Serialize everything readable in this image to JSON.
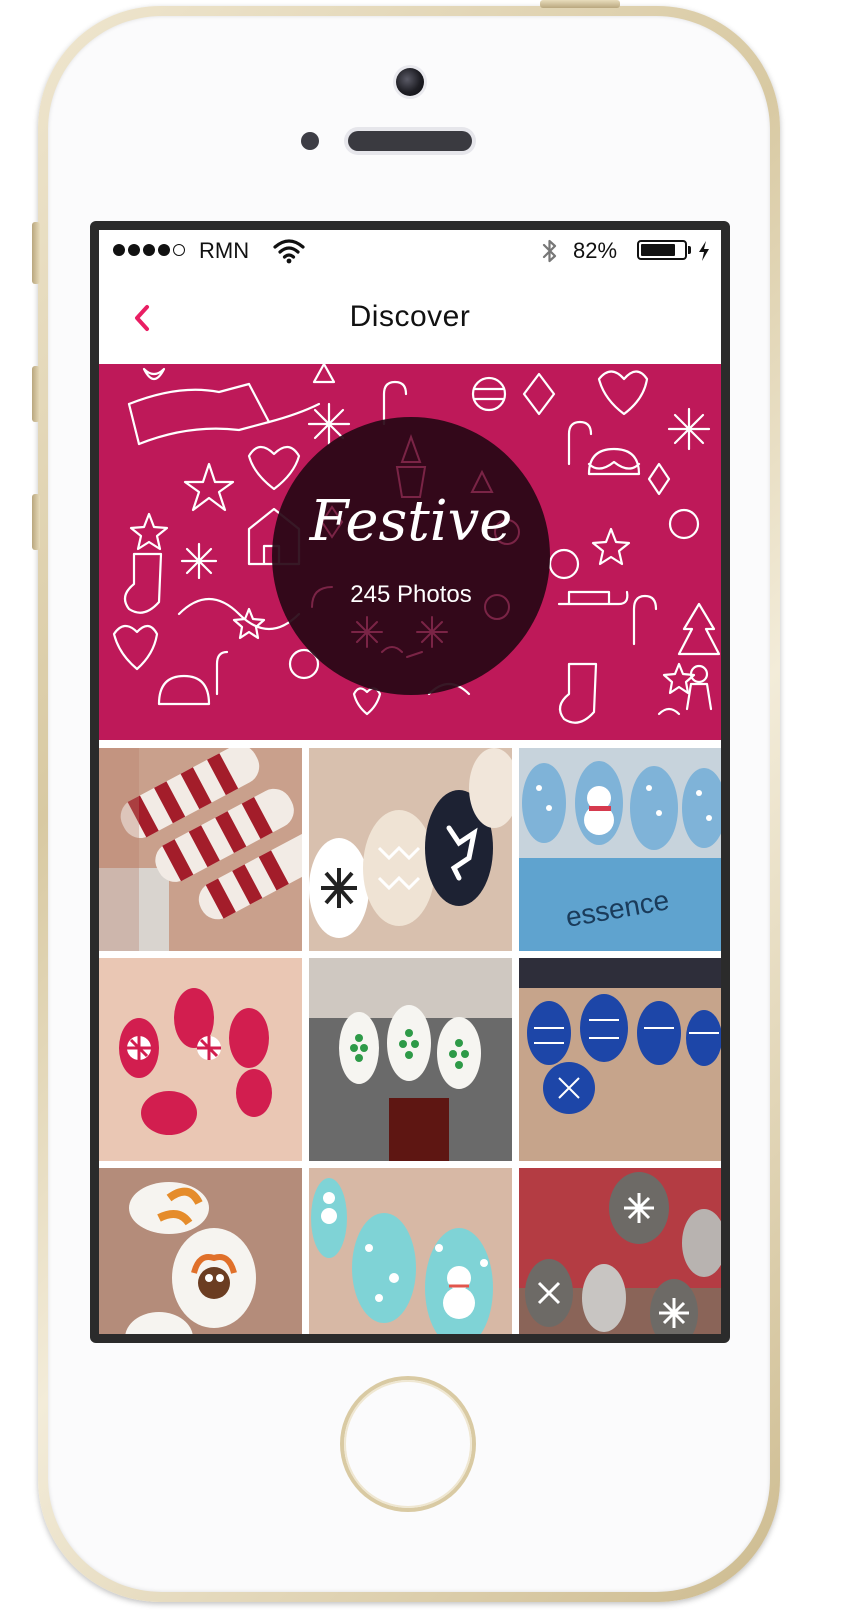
{
  "status_bar": {
    "carrier": "RMN",
    "signal_bars": 4,
    "battery_percent": "82%",
    "battery_level": 0.82
  },
  "nav": {
    "title": "Discover",
    "back_icon": "chevron-left-icon",
    "accent_color": "#e91e63"
  },
  "hero": {
    "title": "Festive",
    "photo_count": "245 Photos",
    "background_color": "#be1959"
  },
  "grid": {
    "tiles": [
      "candy-cane-stripes",
      "reindeer-snowflake",
      "snowman-blue",
      "peppermint-swirl",
      "christmas-tree-dots",
      "hanukkah-sweater",
      "turkey",
      "snowman-turquoise",
      "nordic-sweater-glitter"
    ]
  }
}
